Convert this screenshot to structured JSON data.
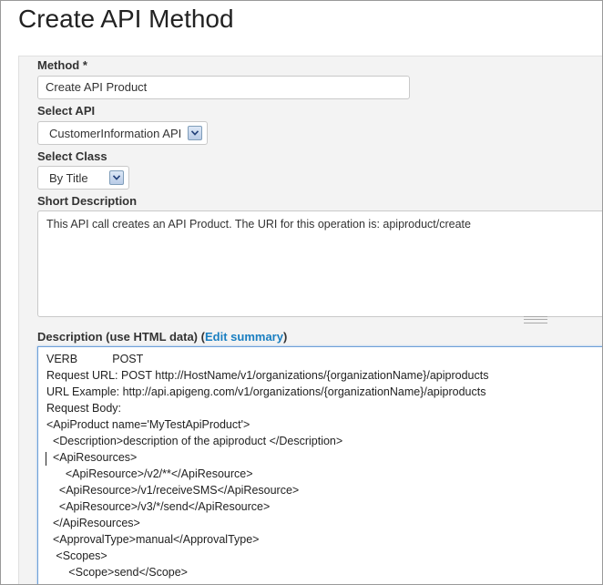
{
  "page": {
    "title": "Create API Method"
  },
  "form": {
    "method": {
      "label": "Method",
      "required_mark": "*",
      "value": "Create API Product"
    },
    "select_api": {
      "label": "Select API",
      "value": "CustomerInformation API"
    },
    "select_class": {
      "label": "Select Class",
      "value": "By Title"
    },
    "short_description": {
      "label": "Short Description",
      "value": "This API call creates an API Product. The URI for this operation is: apiproduct/create"
    },
    "description": {
      "label": "Description (use HTML data)",
      "open_paren": "(",
      "edit_summary_link": "Edit summary",
      "close_paren": ")",
      "lines": [
        "VERB           POST",
        "Request URL: POST http://HostName/v1/organizations/{organizationName}/apiproducts",
        "URL Example: http://api.apigeng.com/v1/organizations/{organizationName}/apiproducts",
        "Request Body:",
        "<ApiProduct name='MyTestApiProduct'>",
        "  <Description>description of the apiproduct </Description>",
        "  <ApiResources>",
        "      <ApiResource>/v2/**</ApiResource>",
        "    <ApiResource>/v1/receiveSMS</ApiResource>",
        "    <ApiResource>/v3/*/send</ApiResource>",
        "  </ApiResources>",
        "  <ApprovalType>manual</ApprovalType>",
        "   <Scopes>",
        "       <Scope>send</Scope>"
      ]
    }
  },
  "icons": {
    "dropdown": "chevron-down-icon"
  },
  "colors": {
    "link": "#1a7fc1",
    "focus_border": "#6fa0d8"
  }
}
